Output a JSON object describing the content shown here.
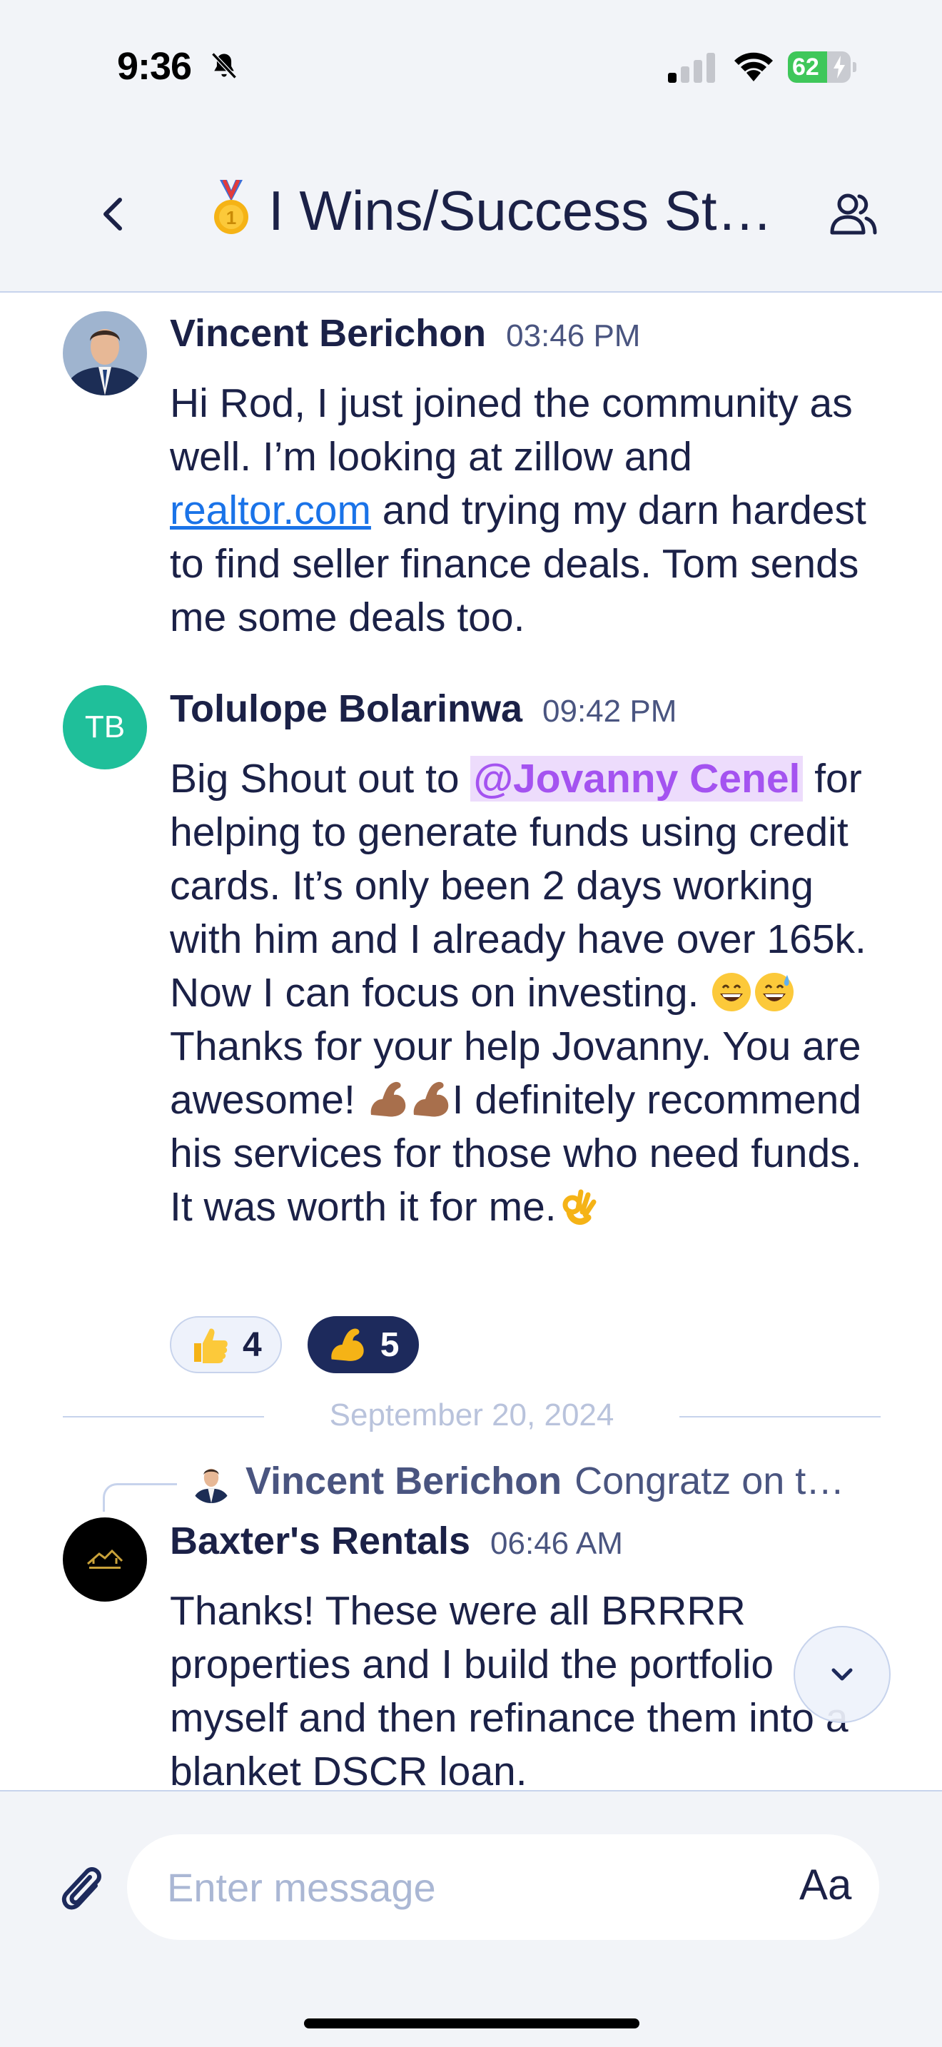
{
  "status_bar": {
    "time": "9:36",
    "battery": "62",
    "battery_level": 0.62,
    "icons": [
      "bell-slash-icon",
      "cellular-signal-icon",
      "wifi-icon",
      "battery-charging-icon"
    ]
  },
  "header": {
    "title": "I Wins/Success St…",
    "title_emoji": "medal-icon",
    "back_icon": "chevron-left-icon",
    "members_icon": "people-icon"
  },
  "messages": [
    {
      "sender": "Vincent Berichon",
      "time": "03:46 PM",
      "body_before_link": "Hi Rod, I just joined the community as well. I’m looking at zillow and ",
      "link": "realtor.com",
      "body_after_link": " and trying my darn hardest to find seller finance deals. Tom sends me some deals too."
    },
    {
      "sender": "Tolulope Bolarinwa",
      "avatar_initials": "TB",
      "time": "09:42 PM",
      "body_1": "Big Shout out to ",
      "mention": "@Jovanny Cenel",
      "body_2": " for helping to generate funds using credit cards. It’s only been 2 days working with him and I already have over 165k. Now I can focus on investing. ",
      "body_3": "Thanks for your help Jovanny. You are awesome! ",
      "body_4": "I definitely recommend his services for those who need funds. It was worth it for me.",
      "reactions": [
        {
          "emoji": "thumbs-up",
          "count": "4",
          "selected": false
        },
        {
          "emoji": "flexed-biceps",
          "count": "5",
          "selected": true
        }
      ]
    },
    {
      "date_divider": "September 20, 2024",
      "reply_to_sender": "Vincent Berichon",
      "reply_to_text": "Congratz on t…",
      "sender": "Baxter's Rentals",
      "time": "06:46 AM",
      "body": "Thanks! These were all BRRRR properties and I build the portfolio myself and then refinance them into a blanket DSCR loan."
    }
  ],
  "composer": {
    "placeholder": "Enter message",
    "format_label": "Aa"
  },
  "colors": {
    "text": "#1b2147",
    "link": "#1a73e8",
    "mention": "#a453f0",
    "mention_bg": "#eddcfc",
    "initials_avatar": "#1fbf9a",
    "reaction_selected": "#1d2a5c"
  }
}
